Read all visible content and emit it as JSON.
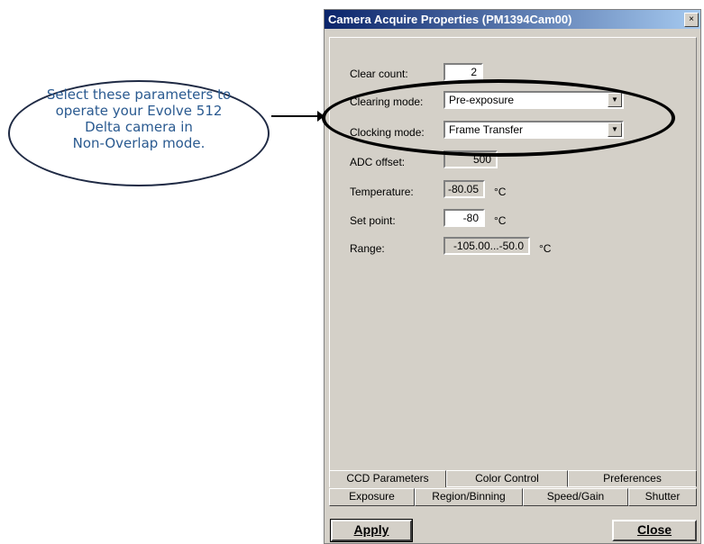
{
  "callout": {
    "lines": [
      "Select these parameters to",
      "operate your Evolve 512",
      "Delta camera in",
      "Non-Overlap mode."
    ]
  },
  "dialog": {
    "title": "Camera Acquire Properties (PM1394Cam00)",
    "close_glyph": "×"
  },
  "fields": {
    "clear_count_label": "Clear count:",
    "clear_count_value": "2",
    "clearing_mode_label": "Clearing mode:",
    "clearing_mode_value": "Pre-exposure",
    "clocking_mode_label": "Clocking mode:",
    "clocking_mode_value": "Frame Transfer",
    "adc_offset_label": "ADC offset:",
    "adc_offset_value": "500",
    "temperature_label": "Temperature:",
    "temperature_value": "-80.05",
    "set_point_label": "Set point:",
    "set_point_value": "-80",
    "range_label": "Range:",
    "range_value": "-105.00...-50.0",
    "unit": "°C"
  },
  "tabs_top": [
    "CCD Parameters",
    "Color Control",
    "Preferences"
  ],
  "tabs_bottom": [
    "Exposure",
    "Region/Binning",
    "Speed/Gain",
    "Shutter"
  ],
  "buttons": {
    "apply": "Apply",
    "close": "Close"
  },
  "icons": {
    "dropdown": "chevron-down-icon",
    "close": "close-icon"
  }
}
